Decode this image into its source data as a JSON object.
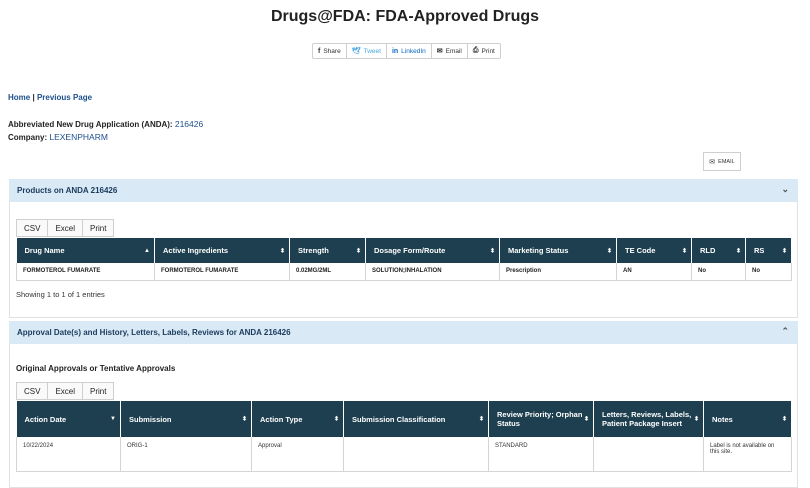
{
  "page": {
    "title": "Drugs@FDA: FDA-Approved Drugs"
  },
  "share": {
    "facebook": "Share",
    "twitter": "Tweet",
    "linkedin": "LinkedIn",
    "email": "Email",
    "print": "Print"
  },
  "breadcrumb": {
    "home": "Home",
    "separator": "|",
    "previous": "Previous Page"
  },
  "application": {
    "anda_label": "Abbreviated New Drug Application (ANDA):",
    "anda_number": "216426",
    "company_label": "Company:",
    "company": "LEXENPHARM"
  },
  "email_button": "EMAIL",
  "products": {
    "header": "Products on ANDA 216426",
    "buttons": [
      "CSV",
      "Excel",
      "Print"
    ],
    "columns": [
      "Drug Name",
      "Active Ingredients",
      "Strength",
      "Dosage Form/Route",
      "Marketing Status",
      "TE Code",
      "RLD",
      "RS"
    ],
    "rows": [
      [
        "FORMOTEROL FUMARATE",
        "FORMOTEROL FUMARATE",
        "0.02MG/2ML",
        "SOLUTION;INHALATION",
        "Prescription",
        "AN",
        "No",
        "No"
      ]
    ],
    "showing": "Showing 1 to 1 of 1 entries"
  },
  "approvals": {
    "header": "Approval Date(s) and History, Letters, Labels, Reviews for ANDA 216426",
    "subheader": "Original Approvals or Tentative Approvals",
    "buttons": [
      "CSV",
      "Excel",
      "Print"
    ],
    "columns": [
      "Action Date",
      "Submission",
      "Action Type",
      "Submission Classification",
      "Review Priority; Orphan Status",
      "Letters, Reviews, Labels, Patient Package Insert",
      "Notes"
    ],
    "rows": [
      [
        "10/22/2024",
        "ORIG-1",
        "Approval",
        "",
        "STANDARD",
        "",
        "Label is not available on this site."
      ]
    ]
  }
}
